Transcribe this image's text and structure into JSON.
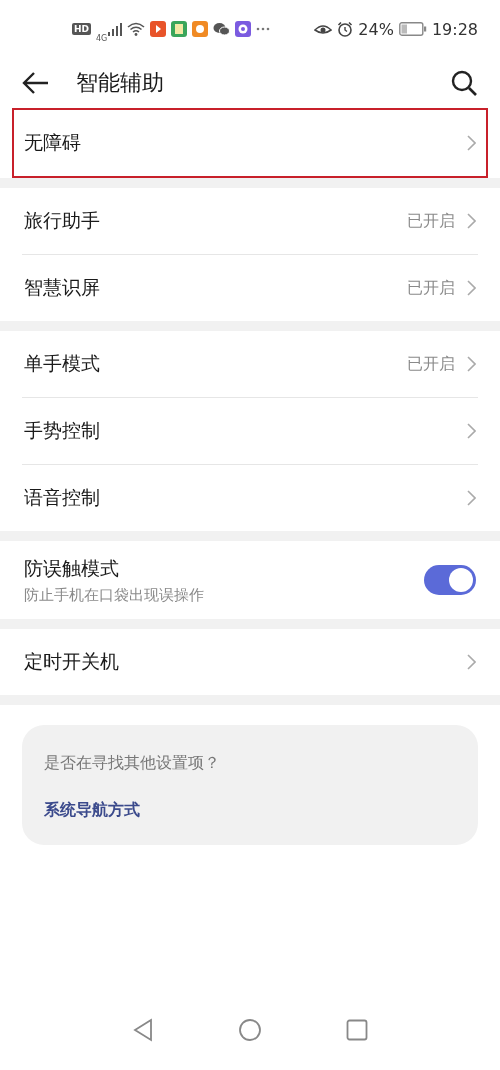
{
  "status_bar": {
    "hd": "HD",
    "network": "4G",
    "battery": "24%",
    "time": "19:28"
  },
  "header": {
    "title": "智能辅助"
  },
  "groups": [
    {
      "items": [
        {
          "kind": "link",
          "title": "无障碍",
          "highlighted": true
        }
      ]
    },
    {
      "items": [
        {
          "kind": "link",
          "title": "旅行助手",
          "value": "已开启",
          "highlighted": false
        },
        {
          "kind": "link",
          "title": "智慧识屏",
          "value": "已开启",
          "highlighted": false
        }
      ]
    },
    {
      "items": [
        {
          "kind": "link",
          "title": "单手模式",
          "value": "已开启",
          "highlighted": false
        },
        {
          "kind": "link",
          "title": "手势控制",
          "highlighted": false
        },
        {
          "kind": "link",
          "title": "语音控制",
          "highlighted": false
        }
      ]
    },
    {
      "items": [
        {
          "kind": "switch",
          "title": "防误触模式",
          "subtitle": "防止手机在口袋出现误操作",
          "on": true
        }
      ]
    },
    {
      "items": [
        {
          "kind": "link",
          "title": "定时开关机",
          "highlighted": false
        }
      ]
    }
  ],
  "suggestion": {
    "question": "是否在寻找其他设置项？",
    "link": "系统导航方式"
  }
}
